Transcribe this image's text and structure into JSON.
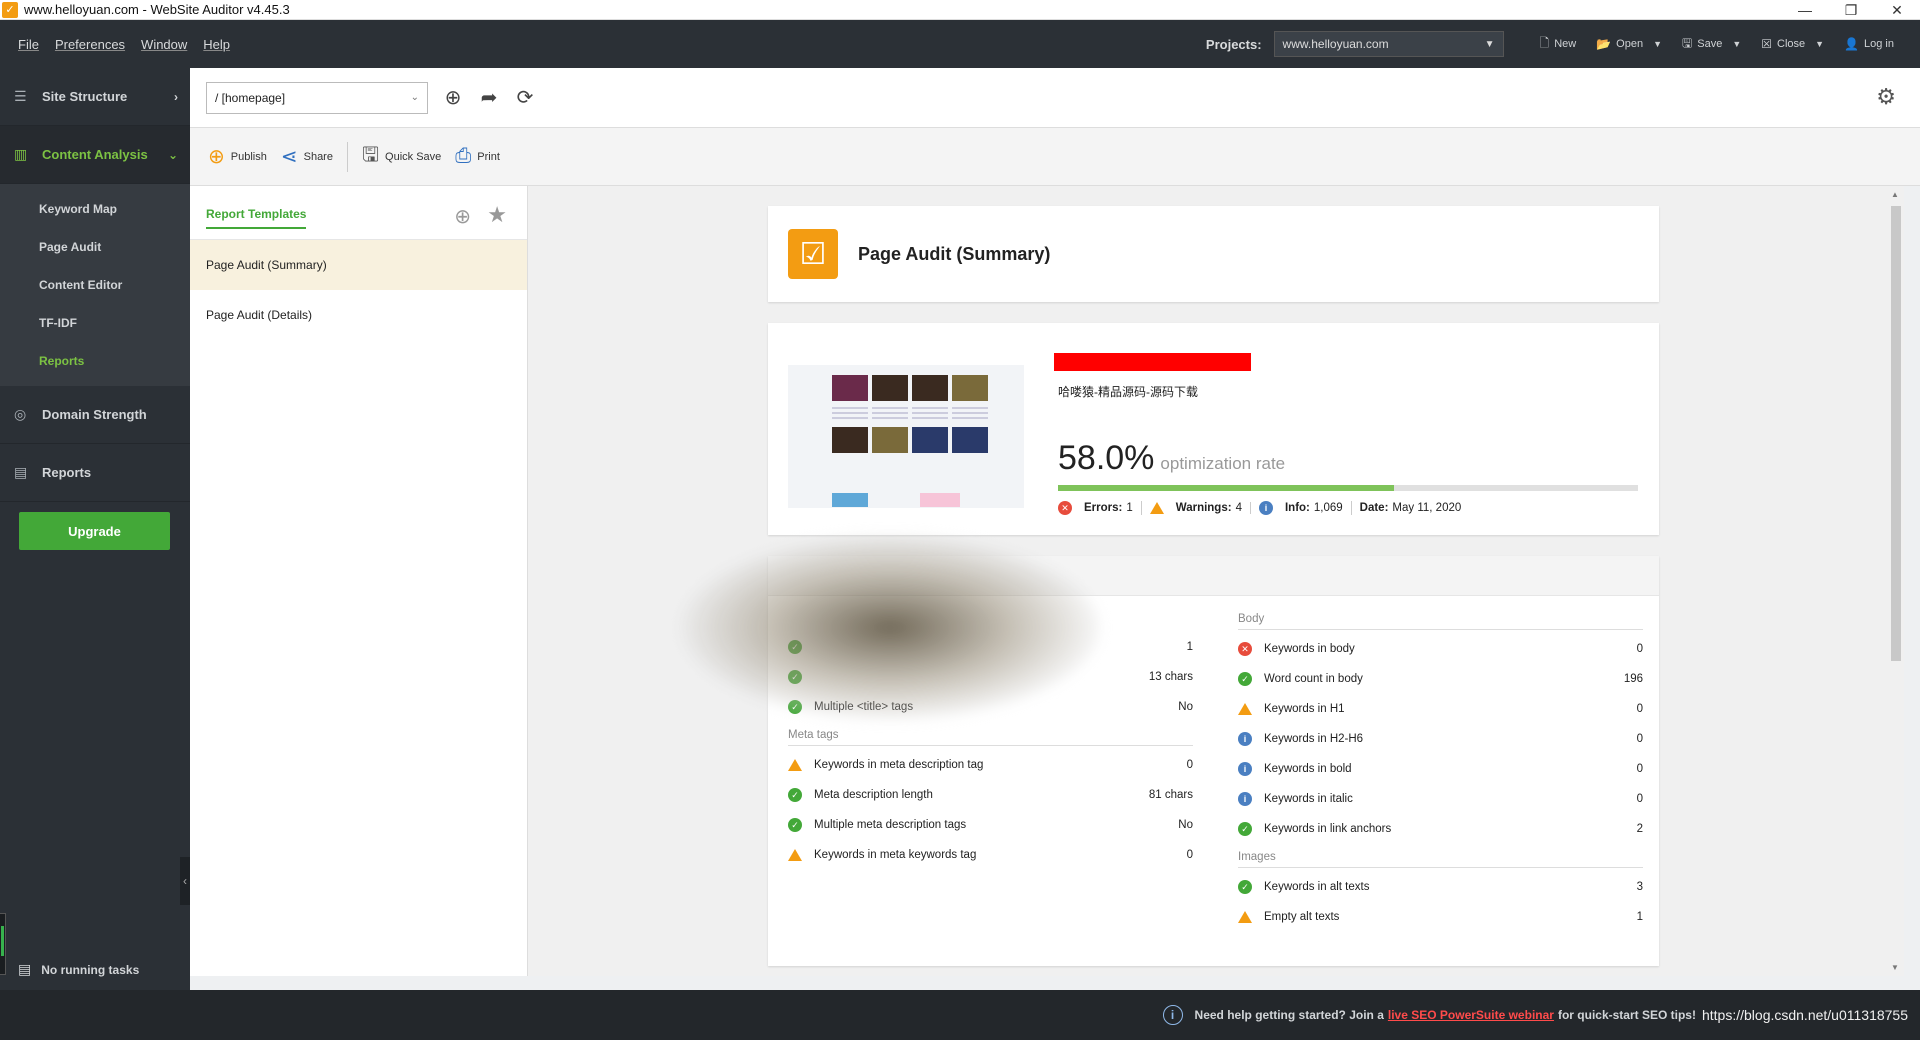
{
  "window": {
    "title": "www.helloyuan.com - WebSite Auditor v4.45.3",
    "app_icon": "check-icon",
    "controls": [
      "—",
      "❐",
      "✕"
    ]
  },
  "menubar": {
    "menus": [
      "File",
      "Preferences",
      "Window",
      "Help"
    ],
    "projects_label": "Projects:",
    "project_value": "www.helloyuan.com",
    "buttons": {
      "new": "New",
      "open": "Open",
      "save": "Save",
      "close": "Close",
      "login": "Log in"
    }
  },
  "sidebar": {
    "sections": {
      "site_structure": "Site Structure",
      "content_analysis": "Content Analysis",
      "domain_strength": "Domain Strength",
      "reports": "Reports"
    },
    "content_analysis_items": [
      "Keyword Map",
      "Page Audit",
      "Content Editor",
      "TF-IDF",
      "Reports"
    ],
    "selected_item": "Reports",
    "upgrade_label": "Upgrade",
    "tasks_label": "No running tasks",
    "accent": "#7cc243"
  },
  "topbar": {
    "url_value": "/ [homepage]"
  },
  "toolbar": {
    "publish": "Publish",
    "share": "Share",
    "quick_save": "Quick Save",
    "print": "Print"
  },
  "templates": {
    "tab": "Report Templates",
    "items": [
      "Page Audit (Summary)",
      "Page Audit (Details)"
    ],
    "selected": "Page Audit (Summary)"
  },
  "report": {
    "title": "Page Audit (Summary)",
    "site_name": "哈喽猿-精品源码-源码下载",
    "optimization_rate": "58.0%",
    "optimization_rate_value": 58.0,
    "optimization_label": "optimization rate",
    "stats": {
      "errors_label": "Errors:",
      "errors": "1",
      "warnings_label": "Warnings:",
      "warnings": "4",
      "info_label": "Info:",
      "info": "1,069",
      "date_label": "Date:",
      "date": "May 11, 2020"
    },
    "left_rows": [
      {
        "status": "ok",
        "label": "",
        "value": "1"
      },
      {
        "status": "ok",
        "label": "",
        "value": "13 chars"
      },
      {
        "status": "ok",
        "label": "Multiple <title> tags",
        "value": "No"
      }
    ],
    "meta_group": "Meta tags",
    "meta_rows": [
      {
        "status": "warn",
        "label": "Keywords in meta description tag",
        "value": "0"
      },
      {
        "status": "ok",
        "label": "Meta description length",
        "value": "81 chars"
      },
      {
        "status": "ok",
        "label": "Multiple meta description tags",
        "value": "No"
      },
      {
        "status": "warn",
        "label": "Keywords in meta keywords tag",
        "value": "0"
      }
    ],
    "body_group": "Body",
    "body_rows": [
      {
        "status": "err",
        "label": "Keywords in body",
        "value": "0"
      },
      {
        "status": "ok",
        "label": "Word count in body",
        "value": "196"
      },
      {
        "status": "warn",
        "label": "Keywords in H1",
        "value": "0"
      },
      {
        "status": "info",
        "label": "Keywords in H2-H6",
        "value": "0"
      },
      {
        "status": "info",
        "label": "Keywords in bold",
        "value": "0"
      },
      {
        "status": "info",
        "label": "Keywords in italic",
        "value": "0"
      },
      {
        "status": "ok",
        "label": "Keywords in link anchors",
        "value": "2"
      }
    ],
    "images_group": "Images",
    "images_rows": [
      {
        "status": "ok",
        "label": "Keywords in alt texts",
        "value": "3"
      },
      {
        "status": "warn",
        "label": "Empty alt texts",
        "value": "1"
      }
    ]
  },
  "statusbar": {
    "prefix": "Need help getting started? Join a",
    "link": "live SEO PowerSuite webinar",
    "suffix": "for quick-start SEO tips!",
    "watermark": "https://blog.csdn.net/u011318755"
  }
}
